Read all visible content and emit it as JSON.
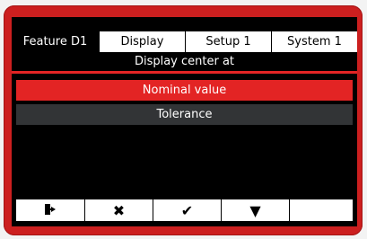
{
  "tabs": [
    {
      "label": "Feature  D1",
      "active": true
    },
    {
      "label": "Display",
      "active": false
    },
    {
      "label": "Setup 1",
      "active": false
    },
    {
      "label": "System 1",
      "active": false
    }
  ],
  "subtitle": "Display center at",
  "options": [
    {
      "label": "Nominal value",
      "selected": true
    },
    {
      "label": "Tolerance",
      "selected": false
    }
  ],
  "footer": {
    "buttons": [
      {
        "icon": "exit-icon",
        "glyph": "⇥"
      },
      {
        "icon": "close-icon",
        "glyph": "✖"
      },
      {
        "icon": "check-icon",
        "glyph": "✔"
      },
      {
        "icon": "down-arrow-icon",
        "glyph": "▼"
      },
      {
        "icon": "",
        "glyph": ""
      }
    ]
  },
  "colors": {
    "bezel": "#cc1f1f",
    "accent": "#e32424",
    "screen": "#000000",
    "option_normal": "#323436"
  }
}
